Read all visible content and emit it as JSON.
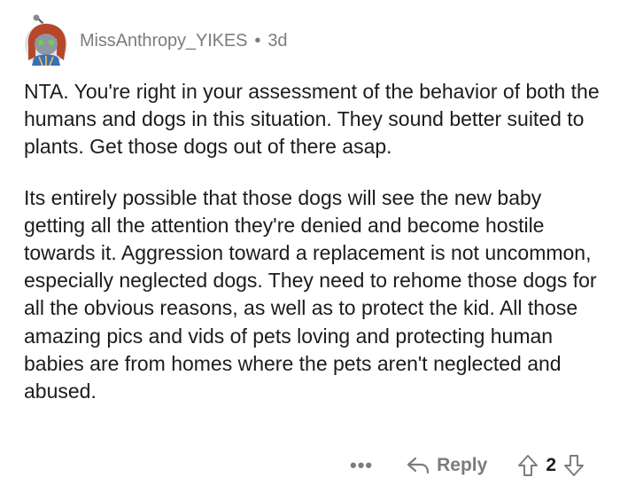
{
  "comment": {
    "username": "MissAnthropy_YIKES",
    "separator": "•",
    "age": "3d",
    "paragraphs": [
      "NTA. You're right in your assessment of the behavior of both the humans and dogs in this situation. They sound better suited to plants. Get those dogs out of there asap.",
      "Its entirely possible that those dogs will see the new baby getting all the attention they're denied and become hostile towards it. Aggression toward a replacement is not uncommon, especially neglected dogs. They need to rehome those dogs for all the obvious reasons, as well as to protect the kid.  All those amazing pics and vids of pets loving and protecting human babies are from homes where the pets aren't neglected and abused."
    ]
  },
  "actions": {
    "more_label": "•••",
    "reply_label": "Reply",
    "vote_count": "2"
  },
  "icons": {
    "avatar": "snoo-avatar-icon",
    "reply": "reply-arrow-icon",
    "upvote": "upvote-arrow-icon",
    "downvote": "downvote-arrow-icon"
  },
  "colors": {
    "text": "#1c1c1c",
    "meta": "#7c7c7c"
  }
}
